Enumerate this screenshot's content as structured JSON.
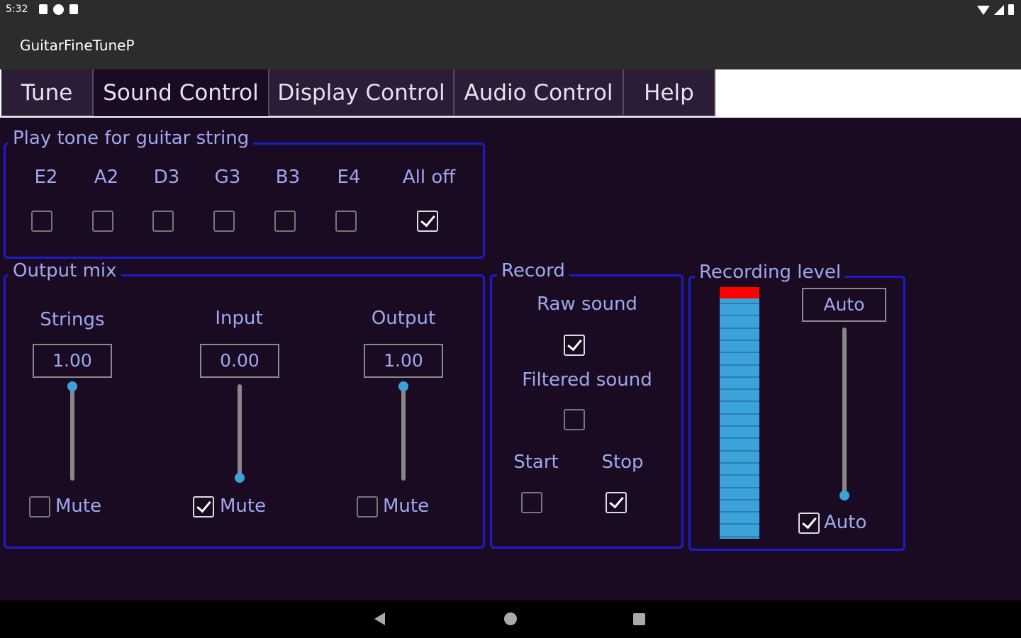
{
  "status": {
    "time": "5:32"
  },
  "app": {
    "title": "GuitarFineTuneP"
  },
  "tabs": [
    {
      "label": "Tune"
    },
    {
      "label": "Sound Control"
    },
    {
      "label": "Display Control"
    },
    {
      "label": "Audio Control"
    },
    {
      "label": "Help"
    }
  ],
  "play_tone": {
    "legend": "Play tone for guitar string",
    "strings": [
      {
        "label": "E2",
        "checked": false
      },
      {
        "label": "A2",
        "checked": false
      },
      {
        "label": "D3",
        "checked": false
      },
      {
        "label": "G3",
        "checked": false
      },
      {
        "label": "B3",
        "checked": false
      },
      {
        "label": "E4",
        "checked": false
      },
      {
        "label": "All off",
        "checked": true
      }
    ]
  },
  "output_mix": {
    "legend": "Output mix",
    "channels": [
      {
        "label": "Strings",
        "value": "1.00",
        "level": 1.0,
        "mute_label": "Mute",
        "muted": false
      },
      {
        "label": "Input",
        "value": "0.00",
        "level": 0.0,
        "mute_label": "Mute",
        "muted": true
      },
      {
        "label": "Output",
        "value": "1.00",
        "level": 1.0,
        "mute_label": "Mute",
        "muted": false
      }
    ]
  },
  "record": {
    "legend": "Record",
    "raw_label": "Raw sound",
    "raw_checked": true,
    "filtered_label": "Filtered sound",
    "filtered_checked": false,
    "start_label": "Start",
    "start_checked": false,
    "stop_label": "Stop",
    "stop_checked": true
  },
  "recording_level": {
    "legend": "Recording level",
    "value_box": "Auto",
    "gain_level": 0.0,
    "auto_label": "Auto",
    "auto_checked": true
  },
  "colors": {
    "background": "#1a0b22",
    "group_border": "#1c1ccc",
    "label": "#9fa8ef",
    "accent": "#3ba3d9",
    "meter_peak": "#ff0000"
  }
}
